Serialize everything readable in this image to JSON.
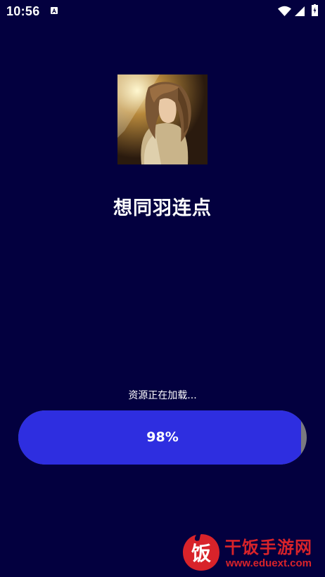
{
  "status_bar": {
    "time": "10:56",
    "icons": [
      "a-notification-icon",
      "wifi-icon",
      "signal-icon",
      "battery-icon"
    ]
  },
  "app": {
    "title": "想同羽连点",
    "avatar_icon": "user-photo-avatar"
  },
  "loading": {
    "message": "资源正在加载...",
    "progress": 98,
    "progress_label": "98%"
  },
  "watermark": {
    "badge_char": "饭",
    "title": "干饭手游网",
    "url": "www.eduext.com"
  },
  "colors": {
    "background": "#03003f",
    "progress_fill": "#2e2ee0",
    "progress_track": "#7a7a80",
    "text": "#ffffff",
    "watermark": "#d8232a"
  }
}
